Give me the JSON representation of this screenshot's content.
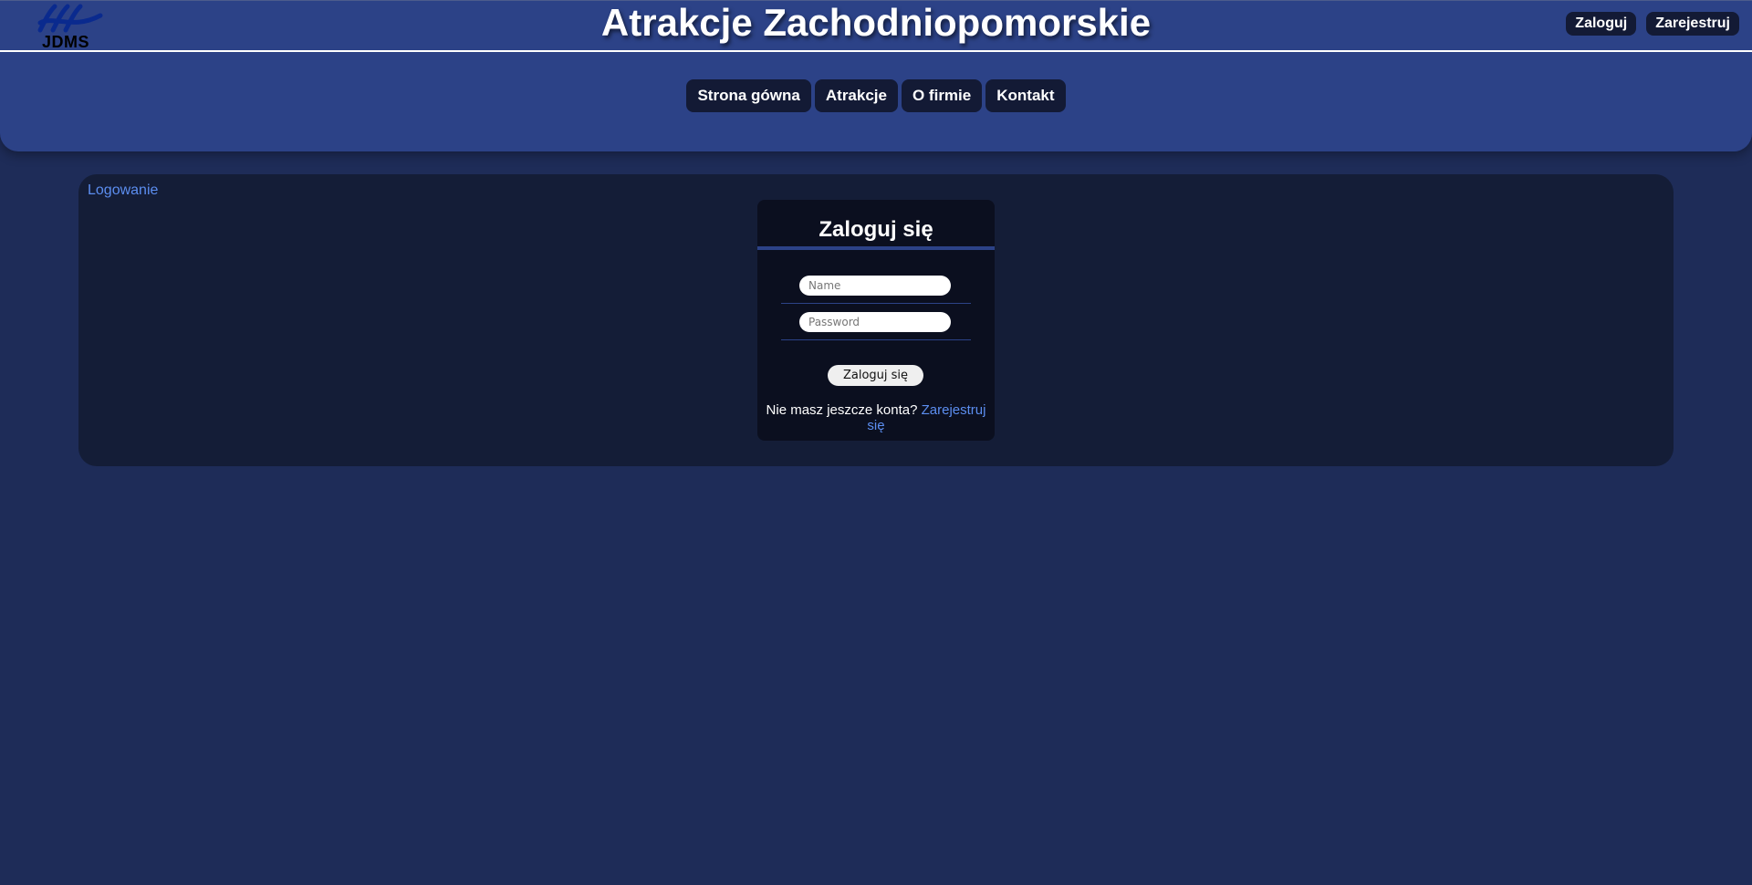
{
  "brand": {
    "logo_text": "JDMS",
    "logo_icon": "waves-logo-icon"
  },
  "header": {
    "title": "Atrakcje Zachodniopomorskie",
    "login_label": "Zaloguj",
    "register_label": "Zarejestruj"
  },
  "nav": {
    "items": [
      {
        "label": "Strona gówna"
      },
      {
        "label": "Atrakcje"
      },
      {
        "label": "O firmie"
      },
      {
        "label": "Kontakt"
      }
    ]
  },
  "breadcrumb": "Logowanie",
  "login_form": {
    "title": "Zaloguj się",
    "name_placeholder": "Name",
    "name_value": "",
    "password_placeholder": "Password",
    "password_value": "",
    "submit_label": "Zaloguj się",
    "register_prompt": "Nie masz jeszcze konta?",
    "register_link": "Zarejestruj się"
  },
  "colors": {
    "page_background": "#1e2c58",
    "header_background": "#2c4287",
    "panel_background": "#141d37",
    "card_background": "#0b0f1f",
    "button_background": "#131a35",
    "link_color": "#5c8ef0"
  }
}
